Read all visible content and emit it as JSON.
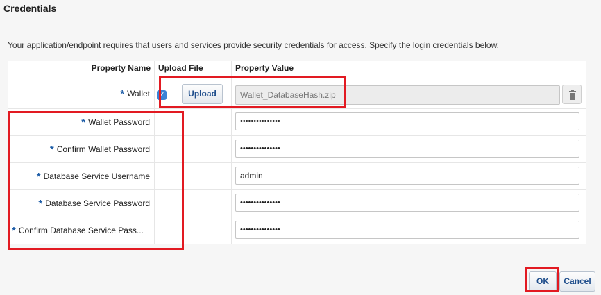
{
  "dialog": {
    "title": "Credentials",
    "description": "Your application/endpoint requires that users and services provide security credentials for access. Specify the login credentials below."
  },
  "table": {
    "headers": {
      "property_name": "Property Name",
      "upload_file": "Upload File",
      "property_value": "Property Value"
    },
    "required_marker": "*",
    "rows": [
      {
        "label": "Wallet",
        "value": "Wallet_DatabaseHash.zip",
        "checked": true,
        "upload_label": "Upload"
      },
      {
        "label": "Wallet Password",
        "value": "•••••••••••••••"
      },
      {
        "label": "Confirm Wallet Password",
        "value": "•••••••••••••••"
      },
      {
        "label": "Database Service Username",
        "value": "admin"
      },
      {
        "label": "Database Service Password",
        "value": "•••••••••••••••"
      },
      {
        "label": "Confirm Database Service Pass...",
        "value": "•••••••••••••••"
      }
    ]
  },
  "buttons": {
    "ok": "OK",
    "cancel": "Cancel"
  },
  "icons": {
    "checkbox": "checkmark-icon",
    "delete": "trash-icon"
  },
  "colors": {
    "highlight": "#e21a22",
    "required_star": "#1f5ea8",
    "checkbox": "#3a82d6",
    "button_text": "#1f4e8c"
  }
}
